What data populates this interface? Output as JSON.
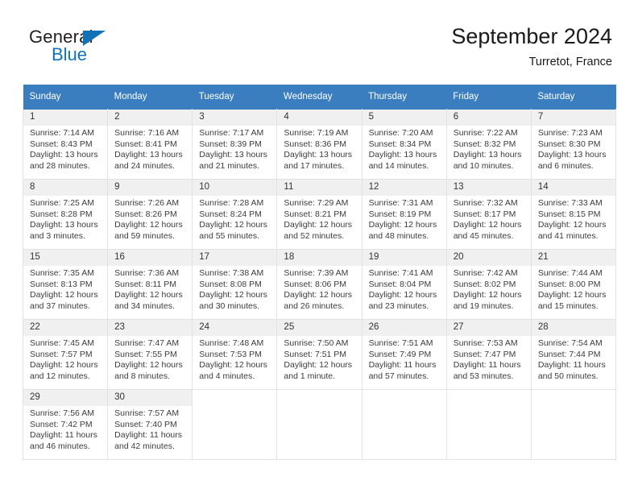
{
  "brand": {
    "name_top": "General",
    "name_bottom": "Blue",
    "accent_color": "#1272b8"
  },
  "header": {
    "title": "September 2024",
    "location": "Turretot, France"
  },
  "theme": {
    "header_row_bg": "#3a7ebf",
    "daynum_bg": "#f0f0f0",
    "grid_border": "#e2e2e2"
  },
  "weekday_headers": [
    "Sunday",
    "Monday",
    "Tuesday",
    "Wednesday",
    "Thursday",
    "Friday",
    "Saturday"
  ],
  "weeks": [
    [
      {
        "day": "1",
        "sunrise": "Sunrise: 7:14 AM",
        "sunset": "Sunset: 8:43 PM",
        "daylight_1": "Daylight: 13 hours",
        "daylight_2": "and 28 minutes."
      },
      {
        "day": "2",
        "sunrise": "Sunrise: 7:16 AM",
        "sunset": "Sunset: 8:41 PM",
        "daylight_1": "Daylight: 13 hours",
        "daylight_2": "and 24 minutes."
      },
      {
        "day": "3",
        "sunrise": "Sunrise: 7:17 AM",
        "sunset": "Sunset: 8:39 PM",
        "daylight_1": "Daylight: 13 hours",
        "daylight_2": "and 21 minutes."
      },
      {
        "day": "4",
        "sunrise": "Sunrise: 7:19 AM",
        "sunset": "Sunset: 8:36 PM",
        "daylight_1": "Daylight: 13 hours",
        "daylight_2": "and 17 minutes."
      },
      {
        "day": "5",
        "sunrise": "Sunrise: 7:20 AM",
        "sunset": "Sunset: 8:34 PM",
        "daylight_1": "Daylight: 13 hours",
        "daylight_2": "and 14 minutes."
      },
      {
        "day": "6",
        "sunrise": "Sunrise: 7:22 AM",
        "sunset": "Sunset: 8:32 PM",
        "daylight_1": "Daylight: 13 hours",
        "daylight_2": "and 10 minutes."
      },
      {
        "day": "7",
        "sunrise": "Sunrise: 7:23 AM",
        "sunset": "Sunset: 8:30 PM",
        "daylight_1": "Daylight: 13 hours",
        "daylight_2": "and 6 minutes."
      }
    ],
    [
      {
        "day": "8",
        "sunrise": "Sunrise: 7:25 AM",
        "sunset": "Sunset: 8:28 PM",
        "daylight_1": "Daylight: 13 hours",
        "daylight_2": "and 3 minutes."
      },
      {
        "day": "9",
        "sunrise": "Sunrise: 7:26 AM",
        "sunset": "Sunset: 8:26 PM",
        "daylight_1": "Daylight: 12 hours",
        "daylight_2": "and 59 minutes."
      },
      {
        "day": "10",
        "sunrise": "Sunrise: 7:28 AM",
        "sunset": "Sunset: 8:24 PM",
        "daylight_1": "Daylight: 12 hours",
        "daylight_2": "and 55 minutes."
      },
      {
        "day": "11",
        "sunrise": "Sunrise: 7:29 AM",
        "sunset": "Sunset: 8:21 PM",
        "daylight_1": "Daylight: 12 hours",
        "daylight_2": "and 52 minutes."
      },
      {
        "day": "12",
        "sunrise": "Sunrise: 7:31 AM",
        "sunset": "Sunset: 8:19 PM",
        "daylight_1": "Daylight: 12 hours",
        "daylight_2": "and 48 minutes."
      },
      {
        "day": "13",
        "sunrise": "Sunrise: 7:32 AM",
        "sunset": "Sunset: 8:17 PM",
        "daylight_1": "Daylight: 12 hours",
        "daylight_2": "and 45 minutes."
      },
      {
        "day": "14",
        "sunrise": "Sunrise: 7:33 AM",
        "sunset": "Sunset: 8:15 PM",
        "daylight_1": "Daylight: 12 hours",
        "daylight_2": "and 41 minutes."
      }
    ],
    [
      {
        "day": "15",
        "sunrise": "Sunrise: 7:35 AM",
        "sunset": "Sunset: 8:13 PM",
        "daylight_1": "Daylight: 12 hours",
        "daylight_2": "and 37 minutes."
      },
      {
        "day": "16",
        "sunrise": "Sunrise: 7:36 AM",
        "sunset": "Sunset: 8:11 PM",
        "daylight_1": "Daylight: 12 hours",
        "daylight_2": "and 34 minutes."
      },
      {
        "day": "17",
        "sunrise": "Sunrise: 7:38 AM",
        "sunset": "Sunset: 8:08 PM",
        "daylight_1": "Daylight: 12 hours",
        "daylight_2": "and 30 minutes."
      },
      {
        "day": "18",
        "sunrise": "Sunrise: 7:39 AM",
        "sunset": "Sunset: 8:06 PM",
        "daylight_1": "Daylight: 12 hours",
        "daylight_2": "and 26 minutes."
      },
      {
        "day": "19",
        "sunrise": "Sunrise: 7:41 AM",
        "sunset": "Sunset: 8:04 PM",
        "daylight_1": "Daylight: 12 hours",
        "daylight_2": "and 23 minutes."
      },
      {
        "day": "20",
        "sunrise": "Sunrise: 7:42 AM",
        "sunset": "Sunset: 8:02 PM",
        "daylight_1": "Daylight: 12 hours",
        "daylight_2": "and 19 minutes."
      },
      {
        "day": "21",
        "sunrise": "Sunrise: 7:44 AM",
        "sunset": "Sunset: 8:00 PM",
        "daylight_1": "Daylight: 12 hours",
        "daylight_2": "and 15 minutes."
      }
    ],
    [
      {
        "day": "22",
        "sunrise": "Sunrise: 7:45 AM",
        "sunset": "Sunset: 7:57 PM",
        "daylight_1": "Daylight: 12 hours",
        "daylight_2": "and 12 minutes."
      },
      {
        "day": "23",
        "sunrise": "Sunrise: 7:47 AM",
        "sunset": "Sunset: 7:55 PM",
        "daylight_1": "Daylight: 12 hours",
        "daylight_2": "and 8 minutes."
      },
      {
        "day": "24",
        "sunrise": "Sunrise: 7:48 AM",
        "sunset": "Sunset: 7:53 PM",
        "daylight_1": "Daylight: 12 hours",
        "daylight_2": "and 4 minutes."
      },
      {
        "day": "25",
        "sunrise": "Sunrise: 7:50 AM",
        "sunset": "Sunset: 7:51 PM",
        "daylight_1": "Daylight: 12 hours",
        "daylight_2": "and 1 minute."
      },
      {
        "day": "26",
        "sunrise": "Sunrise: 7:51 AM",
        "sunset": "Sunset: 7:49 PM",
        "daylight_1": "Daylight: 11 hours",
        "daylight_2": "and 57 minutes."
      },
      {
        "day": "27",
        "sunrise": "Sunrise: 7:53 AM",
        "sunset": "Sunset: 7:47 PM",
        "daylight_1": "Daylight: 11 hours",
        "daylight_2": "and 53 minutes."
      },
      {
        "day": "28",
        "sunrise": "Sunrise: 7:54 AM",
        "sunset": "Sunset: 7:44 PM",
        "daylight_1": "Daylight: 11 hours",
        "daylight_2": "and 50 minutes."
      }
    ],
    [
      {
        "day": "29",
        "sunrise": "Sunrise: 7:56 AM",
        "sunset": "Sunset: 7:42 PM",
        "daylight_1": "Daylight: 11 hours",
        "daylight_2": "and 46 minutes."
      },
      {
        "day": "30",
        "sunrise": "Sunrise: 7:57 AM",
        "sunset": "Sunset: 7:40 PM",
        "daylight_1": "Daylight: 11 hours",
        "daylight_2": "and 42 minutes."
      },
      {
        "day": "",
        "sunrise": "",
        "sunset": "",
        "daylight_1": "",
        "daylight_2": ""
      },
      {
        "day": "",
        "sunrise": "",
        "sunset": "",
        "daylight_1": "",
        "daylight_2": ""
      },
      {
        "day": "",
        "sunrise": "",
        "sunset": "",
        "daylight_1": "",
        "daylight_2": ""
      },
      {
        "day": "",
        "sunrise": "",
        "sunset": "",
        "daylight_1": "",
        "daylight_2": ""
      },
      {
        "day": "",
        "sunrise": "",
        "sunset": "",
        "daylight_1": "",
        "daylight_2": ""
      }
    ]
  ]
}
